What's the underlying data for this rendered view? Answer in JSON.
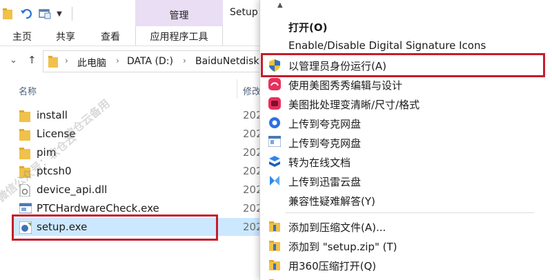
{
  "window": {
    "title": "Setup",
    "context_tab_group": "管理",
    "context_color": "#e9def3"
  },
  "ribbon": {
    "tabs": [
      {
        "label": "主页"
      },
      {
        "label": "共享"
      },
      {
        "label": "查看"
      },
      {
        "label": "应用程序工具"
      }
    ]
  },
  "address": {
    "crumbs": [
      "此电脑",
      "DATA (D:)",
      "BaiduNetdisk"
    ]
  },
  "file_list": {
    "columns": {
      "name": "名称",
      "modified": "修改"
    },
    "rows": [
      {
        "name": "install",
        "date": "202",
        "icon": "folder-icon"
      },
      {
        "name": "License",
        "date": "202",
        "icon": "folder-icon"
      },
      {
        "name": "pim",
        "date": "202",
        "icon": "folder-icon"
      },
      {
        "name": "ptcsh0",
        "date": "202",
        "icon": "folder-icon"
      },
      {
        "name": "device_api.dll",
        "date": "202",
        "icon": "dll-file-icon"
      },
      {
        "name": "PTCHardwareCheck.exe",
        "date": "202",
        "icon": "exe-app-icon"
      },
      {
        "name": "setup.exe",
        "date": "202",
        "icon": "setup-exe-icon",
        "selected": true
      }
    ]
  },
  "watermark": {
    "line1": "微信公众号：软仓云",
    "line2": "软仓云备用"
  },
  "context_menu": {
    "items": [
      {
        "label": "打开(O)",
        "bold": true,
        "icon": ""
      },
      {
        "label": "Enable/Disable Digital Signature Icons",
        "icon": ""
      },
      {
        "label": "以管理员身份运行(A)",
        "icon": "uac-shield-icon"
      },
      {
        "label": "使用美图秀秀编辑与设计",
        "icon": "meitu-icon"
      },
      {
        "label": "美图批处理变清晰/尺寸/格式",
        "icon": "meitu-batch-icon"
      },
      {
        "label": "上传到夸克网盘",
        "icon": "quark-icon"
      },
      {
        "label": "上传到夸克网盘",
        "icon": "quark-window-icon"
      },
      {
        "label": "转为在线文档",
        "icon": "online-doc-icon"
      },
      {
        "label": "上传到迅雷云盘",
        "icon": "xunlei-icon"
      },
      {
        "label": "兼容性疑难解答(Y)",
        "icon": ""
      },
      {
        "label": "添加到压缩文件(A)...",
        "icon": "archive-icon"
      },
      {
        "label": "添加到 \"setup.zip\" (T)",
        "icon": "archive-icon"
      },
      {
        "label": "用360压缩打开(Q)",
        "icon": "archive-icon"
      },
      {
        "label": "...",
        "icon": "archive-icon"
      }
    ]
  },
  "colors": {
    "highlight_border": "#c41d2b",
    "selection": "#cce8ff"
  }
}
